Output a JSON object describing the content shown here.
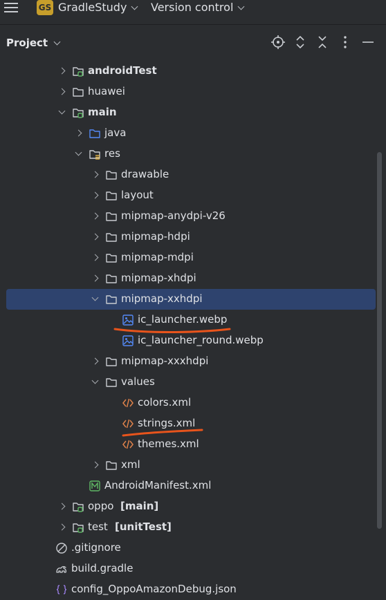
{
  "topbar": {
    "project_badge": "GS",
    "project_name": "GradleStudy",
    "vcs_label": "Version control"
  },
  "panel": {
    "title": "Project"
  },
  "tree": [
    {
      "label": "androidTest",
      "bold": true,
      "depth": 0,
      "arrow": "collapsed",
      "icon": "source-folder-icon"
    },
    {
      "label": "huawei",
      "depth": 0,
      "arrow": "collapsed",
      "icon": "folder-icon"
    },
    {
      "label": "main",
      "bold": true,
      "depth": 0,
      "arrow": "expanded",
      "icon": "source-folder-icon"
    },
    {
      "label": "java",
      "depth": 1,
      "arrow": "collapsed",
      "icon": "java-folder-icon"
    },
    {
      "label": "res",
      "depth": 1,
      "arrow": "expanded",
      "icon": "resource-folder-icon"
    },
    {
      "label": "drawable",
      "depth": 2,
      "arrow": "collapsed",
      "icon": "folder-icon"
    },
    {
      "label": "layout",
      "depth": 2,
      "arrow": "collapsed",
      "icon": "folder-icon"
    },
    {
      "label": "mipmap-anydpi-v26",
      "depth": 2,
      "arrow": "collapsed",
      "icon": "folder-icon"
    },
    {
      "label": "mipmap-hdpi",
      "depth": 2,
      "arrow": "collapsed",
      "icon": "folder-icon"
    },
    {
      "label": "mipmap-mdpi",
      "depth": 2,
      "arrow": "collapsed",
      "icon": "folder-icon"
    },
    {
      "label": "mipmap-xhdpi",
      "depth": 2,
      "arrow": "collapsed",
      "icon": "folder-icon"
    },
    {
      "label": "mipmap-xxhdpi",
      "depth": 2,
      "arrow": "expanded",
      "icon": "folder-icon",
      "selected": true
    },
    {
      "label": "ic_launcher.webp",
      "depth": 3,
      "icon": "image-file-icon"
    },
    {
      "label": "ic_launcher_round.webp",
      "depth": 3,
      "icon": "image-file-icon"
    },
    {
      "label": "mipmap-xxxhdpi",
      "depth": 2,
      "arrow": "collapsed",
      "icon": "folder-icon"
    },
    {
      "label": "values",
      "depth": 2,
      "arrow": "expanded",
      "icon": "folder-icon"
    },
    {
      "label": "colors.xml",
      "depth": 3,
      "icon": "xml-file-icon"
    },
    {
      "label": "strings.xml",
      "depth": 3,
      "icon": "xml-file-icon"
    },
    {
      "label": "themes.xml",
      "depth": 3,
      "icon": "xml-file-icon"
    },
    {
      "label": "xml",
      "depth": 2,
      "arrow": "collapsed",
      "icon": "folder-icon"
    },
    {
      "label": "AndroidManifest.xml",
      "depth": 1,
      "icon": "manifest-file-icon"
    },
    {
      "label": "oppo",
      "suffix": "[main]",
      "depth": 0,
      "arrow": "collapsed",
      "icon": "source-folder-icon"
    },
    {
      "label": "test",
      "suffix": "[unitTest]",
      "depth": 0,
      "arrow": "collapsed",
      "icon": "source-folder-icon"
    },
    {
      "label": ".gitignore",
      "depth": -1,
      "icon": "gitignore-file-icon"
    },
    {
      "label": "build.gradle",
      "depth": -1,
      "icon": "gradle-file-icon"
    },
    {
      "label": "config_OppoAmazonDebug.json",
      "depth": -1,
      "icon": "json-file-icon"
    }
  ],
  "colors": {
    "background": "#2b2d30",
    "selection": "#2e436e",
    "annotation": "#e8541c",
    "folder_stroke": "#c9ccd1",
    "source_dot": "#5fb865",
    "java_folder": "#548af7",
    "xml_icon": "#e0824a"
  }
}
